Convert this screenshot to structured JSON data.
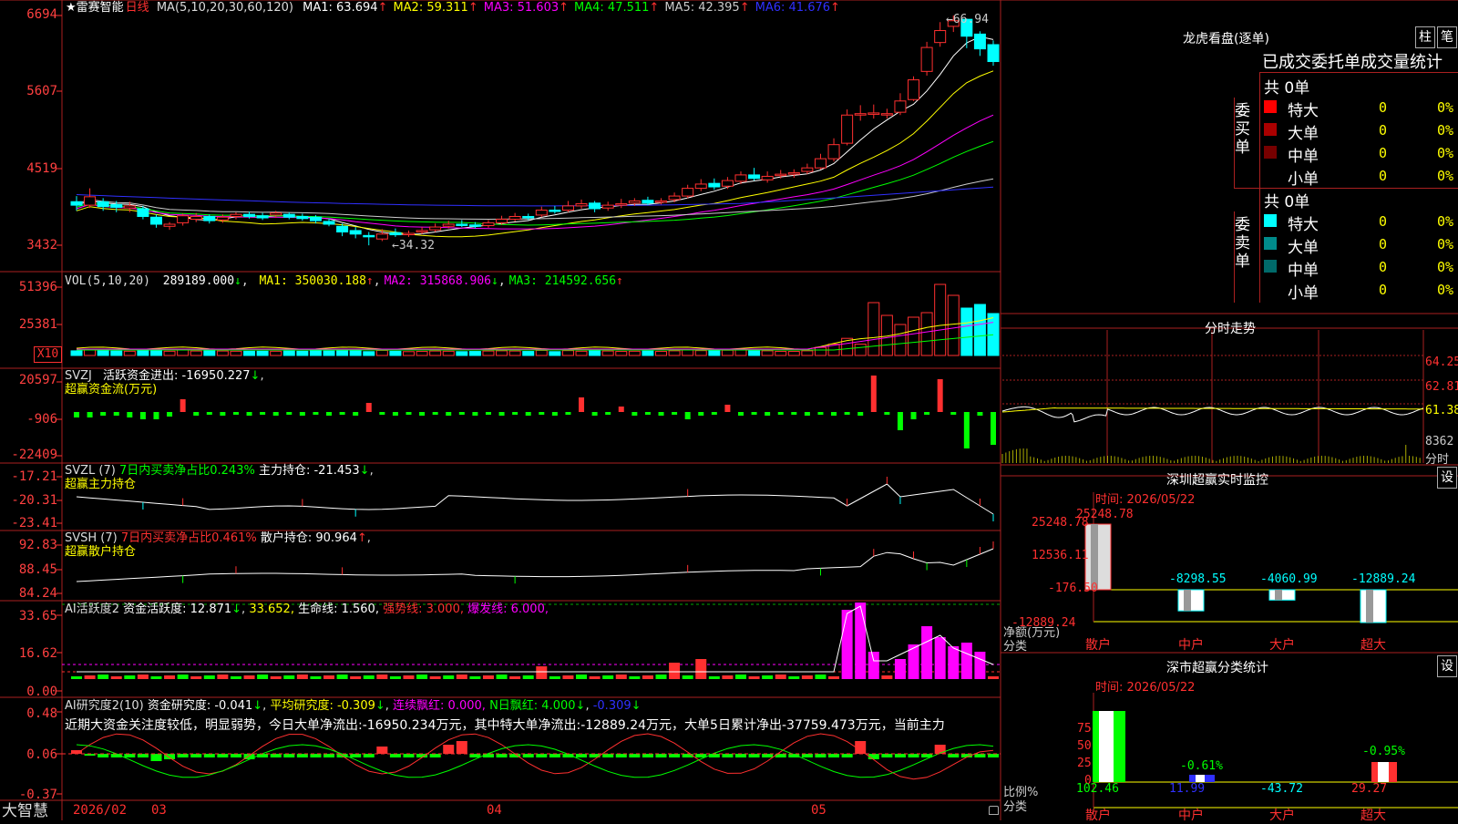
{
  "app": {
    "brand": "大智慧"
  },
  "main": {
    "star": "★",
    "stock_name": "雷赛智能",
    "period": "日线",
    "ma_title": "MA(5,10,20,30,60,120)",
    "ma": [
      {
        "label": "MA1: 63.694",
        "arrow": "↑",
        "color": "#ffffff"
      },
      {
        "label": "MA2: 59.311",
        "arrow": "↑",
        "color": "#ffff00"
      },
      {
        "label": "MA3: 51.603",
        "arrow": "↑",
        "color": "#ff00ff"
      },
      {
        "label": "MA4: 47.511",
        "arrow": "↑",
        "color": "#00ff00"
      },
      {
        "label": "MA5: 42.395",
        "arrow": "↑",
        "color": "#cccccc"
      },
      {
        "label": "MA6: 41.676",
        "arrow": "↑",
        "color": "#3030ff"
      }
    ],
    "y_labels": [
      "6694",
      "5607",
      "4519",
      "3432"
    ],
    "high_mark": "←66.94",
    "low_mark": "←34.32"
  },
  "vol": {
    "title": "VOL(5,10,20)",
    "value": "289189.000",
    "value_arrow": "↓",
    "ma": [
      {
        "label": "MA1: 350030.188",
        "arrow": "↑",
        "color": "#ffff00"
      },
      {
        "label": "MA2: 315868.906",
        "arrow": "↓",
        "color": "#ff00ff"
      },
      {
        "label": "MA3: 214592.656",
        "arrow": "↑",
        "color": "#00ff00"
      }
    ],
    "y_labels": [
      "51396",
      "25381"
    ],
    "unit": "X10"
  },
  "svzj": {
    "title": "SVZJ",
    "label": "活跃资金进出: -16950.227",
    "arrow": "↓",
    "subtitle": "超赢资金流(万元)",
    "y_labels": [
      "20597",
      "-906",
      "-22409"
    ]
  },
  "svzl": {
    "title": "SVZL (7)",
    "label1": "7日内买卖净占比0.243%",
    "label2": "主力持仓: -21.453",
    "arrow": "↓",
    "tail": ",",
    "subtitle": "超赢主力持仓",
    "y_labels": [
      "-17.21",
      "-20.31",
      "-23.41"
    ]
  },
  "svsh": {
    "title": "SVSH (7)",
    "label1": "7日内买卖净占比0.461%",
    "label2": "散户持仓: 90.964",
    "arrow": "↑",
    "tail": ",",
    "subtitle": "超赢散户持仓",
    "y_labels": [
      "92.83",
      "88.45",
      "84.24"
    ]
  },
  "ai1": {
    "title": "AI活跃度2",
    "label1": "资金活跃度: 12.871",
    "arrow1": "↓",
    "label2": "33.652,",
    "label3": "生命线: 1.560,",
    "label4": "强势线: 3.000,",
    "label5": "爆发线: 6.000,",
    "y_labels": [
      "33.65",
      "16.62",
      "0.00"
    ]
  },
  "ai2": {
    "title": "AI研究度2(10)",
    "label1": "资金研究度: -0.041",
    "arrow1": "↓",
    "label2": "平均研究度: -0.309",
    "arrow2": "↓",
    "label3": "连续飘红: 0.000,",
    "label4": "N日飘红: 4.000",
    "arrow4": "↓",
    "label5": "-0.309",
    "arrow5": "↓",
    "comment": "近期大资金关注度较低，明显弱势，今日大单净流出:-16950.234万元，其中特大单净流出:-12889.24万元，大单5日累计净出-37759.473万元，当前主力",
    "y_labels": [
      "0.48",
      "0.06",
      "-0.37"
    ]
  },
  "dates": {
    "first": "2026/02",
    "m1": "03",
    "m2": "04",
    "m3": "05"
  },
  "dragon": {
    "title": "龙虎看盘(逐单)",
    "btn_zhu": "柱",
    "btn_bi": "笔",
    "tabs": [
      "已成交",
      "委托单",
      "成交量统计"
    ],
    "buy": {
      "side": "委买单",
      "total": "共 0单",
      "rows": [
        {
          "name": "特大",
          "count": "0",
          "pct": "0%",
          "color": "#ff0000"
        },
        {
          "name": "大单",
          "count": "0",
          "pct": "0%",
          "color": "#aa0000"
        },
        {
          "name": "中单",
          "count": "0",
          "pct": "0%",
          "color": "#770000"
        },
        {
          "name": "小单",
          "count": "0",
          "pct": "0%",
          "color": "#000000"
        }
      ]
    },
    "sell": {
      "side": "委卖单",
      "total": "共 0单",
      "rows": [
        {
          "name": "特大",
          "count": "0",
          "pct": "0%",
          "color": "#00ffff"
        },
        {
          "name": "大单",
          "count": "0",
          "pct": "0%",
          "color": "#008b8b"
        },
        {
          "name": "中单",
          "count": "0",
          "pct": "0%",
          "color": "#006a6a"
        },
        {
          "name": "小单",
          "count": "0",
          "pct": "0%",
          "color": "#000000"
        }
      ]
    }
  },
  "intraday": {
    "title": "分时走势",
    "y_labels": [
      "64.25",
      "62.81",
      "61.38",
      "8362",
      "分时"
    ]
  },
  "monitor": {
    "title": "深圳超赢实时监控",
    "btn": "设",
    "time": "时间: 2026/05/22",
    "y_labels": [
      "25248.78",
      "12536.11",
      "-176.50",
      "-12889.24"
    ],
    "y_title_1": "净额(万元)",
    "y_title_2": "分类",
    "categories": [
      "散户",
      "中户",
      "大户",
      "超大"
    ],
    "values": [
      25248.78,
      -8298.55,
      -4060.99,
      -12889.24
    ],
    "value_labels": [
      "25248.78",
      "-8298.55",
      "-4060.99",
      "-12889.24"
    ]
  },
  "classify": {
    "title": "深市超赢分类统计",
    "btn": "设",
    "time": "时间: 2026/05/22",
    "y_labels": [
      "75",
      "50",
      "25",
      "0"
    ],
    "y_title_1": "比例%",
    "y_title_2": "分类",
    "categories": [
      "散户",
      "中户",
      "大户",
      "超大"
    ],
    "bottom_values": [
      "102.46",
      "11.99",
      "-43.72",
      "29.27"
    ],
    "pct_labels": [
      "",
      "-0.61%",
      "",
      "-0.95%"
    ]
  },
  "chart_data": {
    "type": "candlestick",
    "title": "雷赛智能 日线",
    "ylim": [
      34.32,
      66.94
    ],
    "candles": [
      [
        40.5,
        40.0,
        41.3,
        39.2
      ],
      [
        40.0,
        41.2,
        42.4,
        39.6
      ],
      [
        40.5,
        39.8,
        41.0,
        39.2
      ],
      [
        40.1,
        39.7,
        40.6,
        39.0
      ],
      [
        39.6,
        39.9,
        40.5,
        39.0
      ],
      [
        39.5,
        38.4,
        39.9,
        38.0
      ],
      [
        38.3,
        37.3,
        38.7,
        36.8
      ],
      [
        37.0,
        37.3,
        37.6,
        36.5
      ],
      [
        37.5,
        38.5,
        38.8,
        37.1
      ],
      [
        38.0,
        38.4,
        38.9,
        37.6
      ],
      [
        38.4,
        37.8,
        38.7,
        37.4
      ],
      [
        37.9,
        38.3,
        38.7,
        37.5
      ],
      [
        38.4,
        38.7,
        39.0,
        38.0
      ],
      [
        38.7,
        38.4,
        39.1,
        38.1
      ],
      [
        38.5,
        38.2,
        38.9,
        37.9
      ],
      [
        38.6,
        38.9,
        39.2,
        38.2
      ],
      [
        38.7,
        38.3,
        39.0,
        38.0
      ],
      [
        38.4,
        38.1,
        38.8,
        37.8
      ],
      [
        38.3,
        37.8,
        38.6,
        37.4
      ],
      [
        37.7,
        37.3,
        38.1,
        37.0
      ],
      [
        37.0,
        36.2,
        37.4,
        35.6
      ],
      [
        36.4,
        35.9,
        36.9,
        35.3
      ],
      [
        35.7,
        35.6,
        36.2,
        34.3
      ],
      [
        35.2,
        35.9,
        36.6,
        34.9
      ],
      [
        36.1,
        35.8,
        36.7,
        35.5
      ],
      [
        35.9,
        36.0,
        36.4,
        35.5
      ],
      [
        36.2,
        36.4,
        36.9,
        35.9
      ],
      [
        36.5,
        36.9,
        37.4,
        36.2
      ],
      [
        37.0,
        37.3,
        37.8,
        36.7
      ],
      [
        37.3,
        37.2,
        37.9,
        36.9
      ],
      [
        37.2,
        37.0,
        37.6,
        36.7
      ],
      [
        37.1,
        37.5,
        37.9,
        36.8
      ],
      [
        37.5,
        38.0,
        38.5,
        37.2
      ],
      [
        38.0,
        38.4,
        38.9,
        37.7
      ],
      [
        38.4,
        38.2,
        38.8,
        37.9
      ],
      [
        38.6,
        39.3,
        39.8,
        38.3
      ],
      [
        39.3,
        39.2,
        39.9,
        38.8
      ],
      [
        39.3,
        39.9,
        40.6,
        39.0
      ],
      [
        39.9,
        40.2,
        40.8,
        39.5
      ],
      [
        40.3,
        39.5,
        40.6,
        39.0
      ],
      [
        39.6,
        40.0,
        40.5,
        39.2
      ],
      [
        40.0,
        40.2,
        40.9,
        39.6
      ],
      [
        40.3,
        40.6,
        41.0,
        39.9
      ],
      [
        40.7,
        40.3,
        41.2,
        40.0
      ],
      [
        40.4,
        40.6,
        41.0,
        40.1
      ],
      [
        40.8,
        41.3,
        41.8,
        40.4
      ],
      [
        41.3,
        42.4,
        42.9,
        41.0
      ],
      [
        42.4,
        43.0,
        43.7,
        42.0
      ],
      [
        43.1,
        42.6,
        43.8,
        42.2
      ],
      [
        42.7,
        43.5,
        44.0,
        42.3
      ],
      [
        43.4,
        44.3,
        44.8,
        43.0
      ],
      [
        44.3,
        43.8,
        45.3,
        43.5
      ],
      [
        43.6,
        44.1,
        44.8,
        43.2
      ],
      [
        44.2,
        44.4,
        45.0,
        43.8
      ],
      [
        44.4,
        44.6,
        45.1,
        43.9
      ],
      [
        44.8,
        45.3,
        45.9,
        44.4
      ],
      [
        45.3,
        46.6,
        47.3,
        45.1
      ],
      [
        46.6,
        48.6,
        49.5,
        46.2
      ],
      [
        48.8,
        52.8,
        53.6,
        48.5
      ],
      [
        52.8,
        53.0,
        54.2,
        52.0
      ],
      [
        53.0,
        53.1,
        54.3,
        52.3
      ],
      [
        52.9,
        53.0,
        53.7,
        52.3
      ],
      [
        53.2,
        54.8,
        55.9,
        52.8
      ],
      [
        55.0,
        57.8,
        58.3,
        54.8
      ],
      [
        59.0,
        62.4,
        63.2,
        58.4
      ],
      [
        63.1,
        64.8,
        66.0,
        62.5
      ],
      [
        65.4,
        66.2,
        66.94,
        64.6
      ],
      [
        66.4,
        64.0,
        66.5,
        62.3
      ],
      [
        64.3,
        62.2,
        64.7,
        61.2
      ],
      [
        62.8,
        60.4,
        63.4,
        59.8
      ]
    ]
  }
}
